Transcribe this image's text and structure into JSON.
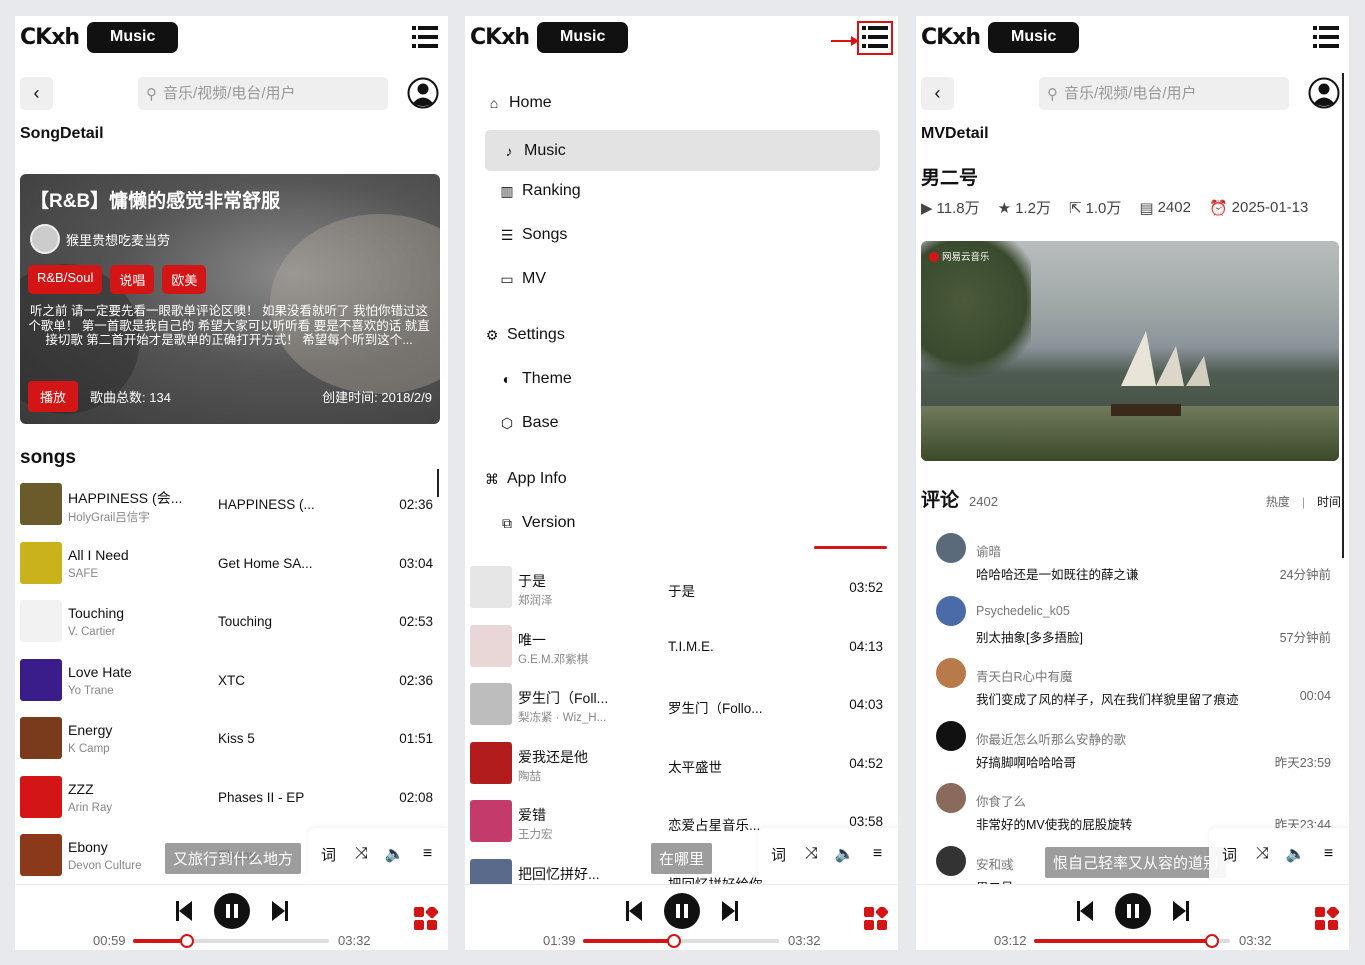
{
  "app": {
    "logo": "CKxh",
    "badge": "Music"
  },
  "search": {
    "placeholder": "音乐/视频/电台/用户"
  },
  "song_detail": {
    "page_title": "SongDetail",
    "playlist_title": "【R&B】慵懒的感觉非常舒服",
    "creator": "猴里贵想吃麦当劳",
    "tags": [
      "R&B/Soul",
      "说唱",
      "欧美"
    ],
    "description": "听之前 请一定要先看一眼歌单评论区噢！ 如果没看就听了 我怕你错过这个歌单！ 第一首歌是我自己的 希望大家可以听听看 要是不喜欢的话 就直接切歌 第二首开始才是歌单的正确打开方式！ 希望每个听到这个...",
    "play_label": "播放",
    "song_count": "歌曲总数: 134",
    "created": "创建时间: 2018/2/9",
    "section_title": "songs",
    "songs": [
      {
        "name": "HAPPINESS (会...",
        "artist": "HolyGrail吕信宇",
        "album": "HAPPINESS (...",
        "duration": "02:36",
        "color": "#6b5a2a"
      },
      {
        "name": "All I Need",
        "artist": "SAFE",
        "album": "Get Home SA...",
        "duration": "03:04",
        "color": "#c9b21c"
      },
      {
        "name": "Touching",
        "artist": "V. Cartier",
        "album": "Touching",
        "duration": "02:53",
        "color": "#f2f2f2"
      },
      {
        "name": "Love Hate",
        "artist": "Yo Trane",
        "album": "XTC",
        "duration": "02:36",
        "color": "#3a1c8a"
      },
      {
        "name": "Energy",
        "artist": "K Camp",
        "album": "Kiss 5",
        "duration": "01:51",
        "color": "#7a3a1c"
      },
      {
        "name": "ZZZ",
        "artist": "Arin Ray",
        "album": "Phases II - EP",
        "duration": "02:08",
        "color": "#d41515"
      },
      {
        "name": "Ebony",
        "artist": "Devon Culture",
        "album": "Ebony",
        "duration": "",
        "color": "#8a3a1a"
      }
    ],
    "lyric": "又旅行到什么地方",
    "player": {
      "current": "00:59",
      "total": "03:32",
      "progress": 0.278
    }
  },
  "menu": {
    "items": [
      {
        "label": "Home",
        "icon": "home-icon",
        "glyph": "⌂"
      },
      {
        "label": "Music",
        "icon": "music-note-icon",
        "glyph": "♪",
        "selected": true
      },
      {
        "label": "Ranking",
        "icon": "ranking-chart-icon",
        "glyph": "▥"
      },
      {
        "label": "Songs",
        "icon": "songs-list-icon",
        "glyph": "☰"
      },
      {
        "label": "MV",
        "icon": "tv-icon",
        "glyph": "▭"
      },
      {
        "label": "Settings",
        "icon": "gear-icon",
        "glyph": "⚙"
      },
      {
        "label": "Theme",
        "icon": "palette-icon",
        "glyph": "◐"
      },
      {
        "label": "Base",
        "icon": "hexagon-icon",
        "glyph": "⬡"
      },
      {
        "label": "App Info",
        "icon": "grid-icon",
        "glyph": "⌘"
      },
      {
        "label": "Version",
        "icon": "version-icon",
        "glyph": "⧉"
      }
    ],
    "songs": [
      {
        "name": "于是",
        "artist": "郑润泽",
        "album": "于是",
        "duration": "03:52",
        "color": "#e6e6e6"
      },
      {
        "name": "唯一",
        "artist": "G.E.M.邓紫棋",
        "album": "T.I.M.E.",
        "duration": "04:13",
        "color": "#e9d6d6"
      },
      {
        "name": "罗生门（Foll...",
        "artist": "梨冻紧 · Wiz_H...",
        "album": "罗生门（Follo...",
        "duration": "04:03",
        "color": "#bdbdbd"
      },
      {
        "name": "爱我还是他",
        "artist": "陶喆",
        "album": "太平盛世",
        "duration": "04:52",
        "color": "#b21c1c"
      },
      {
        "name": "爱错",
        "artist": "王力宏",
        "album": "恋爱占星音乐...",
        "duration": "03:58",
        "color": "#c43a6a"
      },
      {
        "name": "把回忆拼好...",
        "artist": "",
        "album": "把回忆拼好给你",
        "duration": "",
        "color": "#5a6a8a"
      }
    ],
    "lyric": "在哪里",
    "player": {
      "current": "01:39",
      "total": "03:32",
      "progress": 0.466
    }
  },
  "mv_detail": {
    "page_title": "MVDetail",
    "mv_title": "男二号",
    "stats": {
      "plays": "11.8万",
      "likes": "1.2万",
      "shares": "1.0万",
      "comments": "2402",
      "date": "2025-01-13"
    },
    "video_badge": "网易云音乐",
    "comments_title": "评论",
    "comments_count": "2402",
    "sort_hot": "热度",
    "sort_sep": "|",
    "sort_time": "时间",
    "comments": [
      {
        "user": "谕暗",
        "content": "哈哈哈还是一如既往的薛之谦",
        "time": "24分钟前",
        "color": "#5a6a7a"
      },
      {
        "user": "Psychedelic_k05",
        "content": "别太抽象[多多捂脸]",
        "time": "57分钟前",
        "color": "#4a6aa8"
      },
      {
        "user": "青天白R心中有魔",
        "content": "我们变成了风的样子，风在我们样貌里留了痕迹",
        "time": "00:04",
        "color": "#b87a4a"
      },
      {
        "user": "你最近怎么听那么安静的歌",
        "content": "好搞脚啊哈哈哈哥",
        "time": "昨天23:59",
        "color": "#111111"
      },
      {
        "user": "你食了么",
        "content": "非常好的MV使我的屁股旋转",
        "time": "昨天23:44",
        "color": "#8a6a5a"
      },
      {
        "user": "安和彧",
        "content": "男二号",
        "time": "",
        "color": "#333333"
      }
    ],
    "lyric": "恨自己轻率又从容的道别",
    "player": {
      "current": "03:12",
      "total": "03:32",
      "progress": 0.906
    }
  }
}
